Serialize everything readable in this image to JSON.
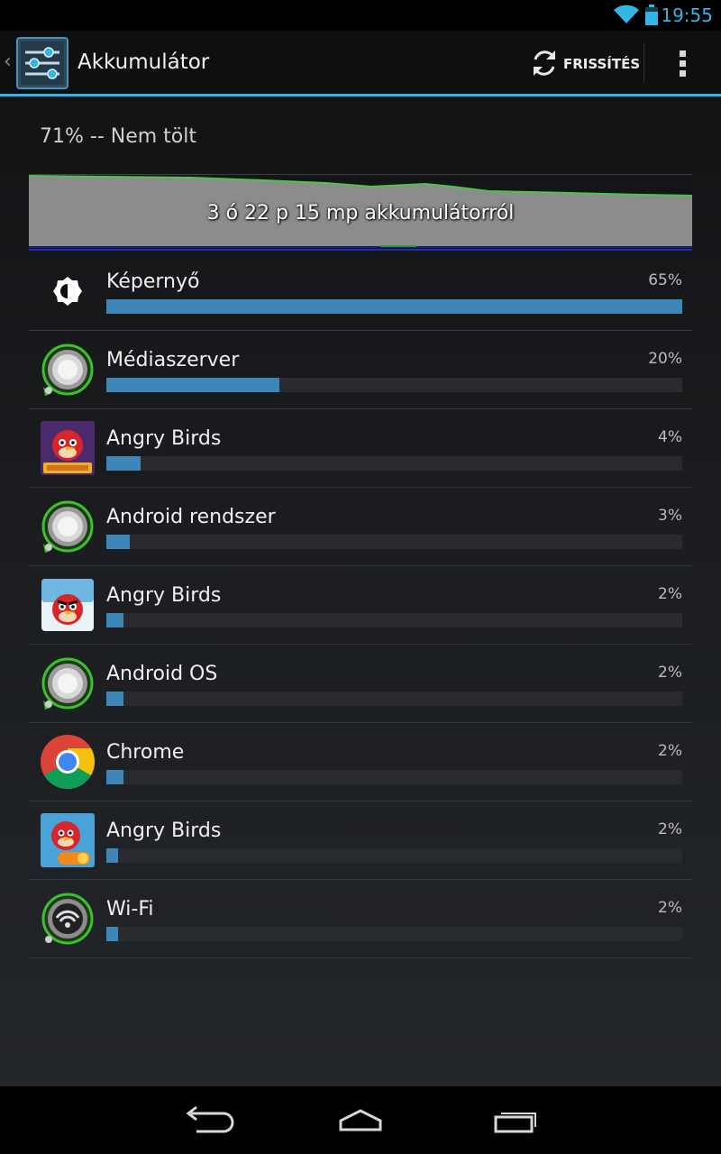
{
  "status_bar": {
    "time": "19:55",
    "icons": [
      "wifi-icon",
      "battery-icon"
    ],
    "accent_color": "#33b5e5"
  },
  "action_bar": {
    "title": "Akkumulátor",
    "refresh_label": "FRISSÍTÉS",
    "icons": [
      "settings-sliders-icon",
      "refresh-icon",
      "overflow-menu-icon"
    ]
  },
  "summary": {
    "status": "71% -- Nem tölt",
    "graph_label": "3 ó 22 p 15 mp akkumulátorról"
  },
  "usage": [
    {
      "name": "Képernyő",
      "percent": "65%",
      "level": 1.0,
      "icon": "brightness-icon"
    },
    {
      "name": "Médiaszerver",
      "percent": "20%",
      "level": 0.3,
      "icon": "android-system-icon"
    },
    {
      "name": "Angry Birds",
      "percent": "4%",
      "level": 0.06,
      "icon": "angry-birds-seasons-icon"
    },
    {
      "name": "Android rendszer",
      "percent": "3%",
      "level": 0.04,
      "icon": "android-system-icon"
    },
    {
      "name": "Angry Birds",
      "percent": "2%",
      "level": 0.03,
      "icon": "angry-birds-icon"
    },
    {
      "name": "Android OS",
      "percent": "2%",
      "level": 0.03,
      "icon": "android-system-icon"
    },
    {
      "name": "Chrome",
      "percent": "2%",
      "level": 0.03,
      "icon": "chrome-icon"
    },
    {
      "name": "Angry Birds",
      "percent": "2%",
      "level": 0.02,
      "icon": "angry-birds-rio-icon"
    },
    {
      "name": "Wi-Fi",
      "percent": "2%",
      "level": 0.02,
      "icon": "wifi-settings-icon"
    }
  ],
  "bar_color": "#3d86b7",
  "nav_bar": {
    "icons": [
      "back-icon",
      "home-icon",
      "recent-apps-icon"
    ]
  }
}
